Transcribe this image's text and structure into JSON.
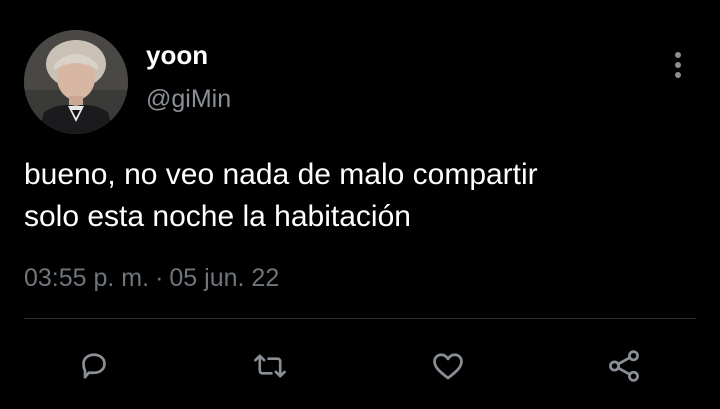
{
  "tweet": {
    "display_name": "yoon",
    "handle": "@giMin",
    "text_lines": [
      "bueno, no veo nada de malo compartir",
      "solo esta noche la habitación"
    ],
    "time": "03:55 p. m.",
    "separator": "·",
    "date": "05 jun. 22"
  },
  "icons": {
    "more": "more-vertical-icon",
    "reply": "reply-icon",
    "retweet": "retweet-icon",
    "like": "heart-icon",
    "share": "share-icon"
  },
  "colors": {
    "background": "#000000",
    "primary_text": "#ffffff",
    "secondary_text": "#8a8f95",
    "icon": "#8a8f95",
    "divider": "#2f3336"
  }
}
